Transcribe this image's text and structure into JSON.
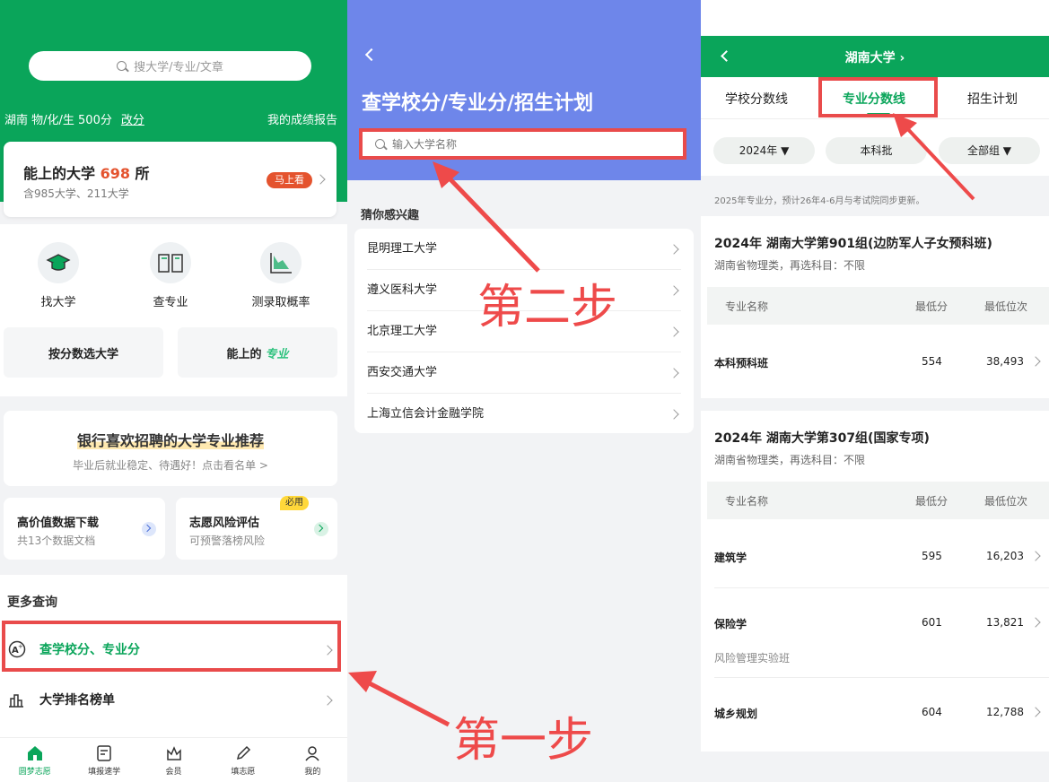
{
  "panel1": {
    "search_placeholder": "搜大学/专业/文章",
    "score_text": "湖南 物/化/生 500分",
    "edit_link": "改分",
    "report_link": "我的成绩报告",
    "uni_card": {
      "prefix": "能上的大学 ",
      "count": "698",
      "suffix": " 所",
      "sub": "含985大学、211大学",
      "badge": "马上看"
    },
    "menu": [
      {
        "label": "找大学",
        "icon": "graduation-cap-icon"
      },
      {
        "label": "查专业",
        "icon": "book-icon"
      },
      {
        "label": "测录取概率",
        "icon": "chart-icon"
      }
    ],
    "btn_score_select": "按分数选大学",
    "btn_major_prefix": "能上的",
    "btn_major_accent": "专业",
    "rec_title": "银行喜欢招聘的大学专业推荐",
    "rec_sub": "毕业后就业稳定、待遇好！点击看名单 >",
    "small1": {
      "title": "高价值数据下载",
      "sub": "共13个数据文档"
    },
    "small2": {
      "title": "志愿风险评估",
      "sub": "可预警落榜风险",
      "badge": "必用"
    },
    "more_title": "更多查询",
    "rows": [
      {
        "label": "查学校分、专业分"
      },
      {
        "label": "大学排名榜单"
      }
    ],
    "tabs": [
      "圆梦志愿",
      "填报速学",
      "会员",
      "填志愿",
      "我的"
    ],
    "step_label": "第一步"
  },
  "panel2": {
    "title": "查学校分/专业分/招生计划",
    "input_placeholder": "输入大学名称",
    "section": "猜你感兴趣",
    "items": [
      "昆明理工大学",
      "遵义医科大学",
      "北京理工大学",
      "西安交通大学",
      "上海立信会计金融学院"
    ],
    "step_label": "第二步"
  },
  "panel3": {
    "uni_name": "湖南大学",
    "tabs": [
      "学校分数线",
      "专业分数线",
      "招生计划"
    ],
    "filters": [
      "2024年",
      "本科批",
      "全部组"
    ],
    "note": "2025年专业分，预计26年4-6月与考试院同步更新。",
    "columns": [
      "专业名称",
      "最低分",
      "最低位次"
    ],
    "groups": [
      {
        "title": "2024年 湖南大学第901组(边防军人子女预科班)",
        "sub": "湖南省物理类，再选科目：不限",
        "rows": [
          {
            "name": "本科预科班",
            "score": "554",
            "rank": "38,493",
            "note": ""
          }
        ]
      },
      {
        "title": "2024年 湖南大学第307组(国家专项)",
        "sub": "湖南省物理类，再选科目：不限",
        "rows": [
          {
            "name": "建筑学",
            "score": "595",
            "rank": "16,203",
            "note": ""
          },
          {
            "name": "保险学",
            "score": "601",
            "rank": "13,821",
            "note": "风险管理实验班"
          },
          {
            "name": "城乡规划",
            "score": "604",
            "rank": "12,788",
            "note": ""
          }
        ]
      }
    ]
  },
  "colors": {
    "green": "#0aa55a",
    "blue": "#6e86ea",
    "red": "#e94b4b",
    "orange": "#e4532e"
  }
}
